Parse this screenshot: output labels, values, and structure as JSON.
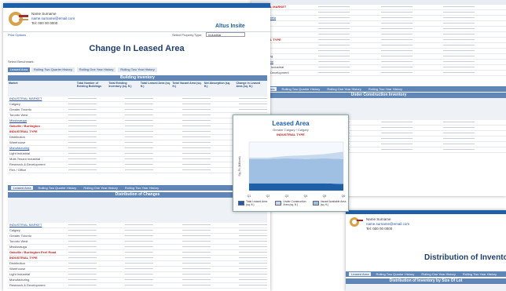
{
  "main_sheet": {
    "contact_name": "Name Surname",
    "contact_email": "name.surname@email.com",
    "contact_phone": "Tel: 000 00 0000",
    "brand_right": "Altus Insite",
    "select_label": "Select Property Type:",
    "select_value": "Industrial",
    "title": "Change In Leased Area",
    "summary_tab": "Leased Area",
    "tabs": [
      "Rolling Two Quarter History",
      "Rolling One Year History",
      "Rolling Two Year History"
    ],
    "inventory_title": "Building Inventory",
    "inventory_columns": [
      "Market",
      "Total Number of Existing Buildings",
      "Total Existing Inventory (sq. ft.)",
      "Total Leased Area (sq. ft.)",
      "Total Vacant Area (sq. ft.)",
      "Net Absorption (sq. ft.)",
      "Change in Leased Area (sq. ft.)"
    ],
    "inventory_rows": [
      {
        "label": "INDUSTRIAL MARKET",
        "style": "link"
      },
      {
        "label": "Calgary",
        "style": "plain"
      },
      {
        "label": "Greater Toronto",
        "style": "plain"
      },
      {
        "label": "Toronto West",
        "style": "plain"
      },
      {
        "label": "Mississauga",
        "style": "link"
      },
      {
        "label": "Oakville / Burlington",
        "style": "red"
      },
      {
        "label": "INDUSTRIAL TYPE",
        "style": "red"
      },
      {
        "label": "Distribution",
        "style": "plain"
      },
      {
        "label": "Warehouse",
        "style": "plain"
      },
      {
        "label": "Manufacturing",
        "style": "link"
      },
      {
        "label": "Light Industrial",
        "style": "plain"
      },
      {
        "label": "Multi-Tenant Industrial",
        "style": "plain"
      },
      {
        "label": "Research & Development",
        "style": "plain"
      },
      {
        "label": "Flex / Office",
        "style": "plain"
      }
    ],
    "distribution_title": "Distribution of Changes",
    "distribution_rows": [
      {
        "label": "INDUSTRIAL MARKET",
        "style": "link"
      },
      {
        "label": "Calgary",
        "style": "plain"
      },
      {
        "label": "Greater Toronto",
        "style": "plain"
      },
      {
        "label": "Toronto West",
        "style": "plain"
      },
      {
        "label": "Mississauga",
        "style": "plain"
      },
      {
        "label": "Oakville / Burlington Peel Road",
        "style": "red"
      },
      {
        "label": "INDUSTRIAL TYPE",
        "style": "red"
      },
      {
        "label": "Distribution",
        "style": "plain"
      },
      {
        "label": "Warehouse",
        "style": "plain"
      },
      {
        "label": "Light Industrial",
        "style": "plain"
      },
      {
        "label": "Manufacturing",
        "style": "plain"
      },
      {
        "label": "Research & Development",
        "style": "plain"
      }
    ]
  },
  "right_sheet": {
    "section_title": "Under Construction Inventory",
    "tabs": [
      "Leased Area",
      "Rolling Two Quarter History",
      "Rolling One Year History",
      "Rolling Two Year History"
    ],
    "rows": [
      {
        "label": "INDUSTRIAL MARKET",
        "style": "red"
      },
      {
        "label": "Calgary",
        "style": "plain"
      },
      {
        "label": "British Columbia",
        "style": "link"
      },
      {
        "label": "Vancouver",
        "style": "plain"
      },
      {
        "label": "Toronto",
        "style": "plain"
      },
      {
        "label": "Ottawa",
        "style": "link"
      },
      {
        "label": "INDUSTRIAL TYPE",
        "style": "red"
      },
      {
        "label": "Warehouse",
        "style": "plain"
      },
      {
        "label": "Distribution",
        "style": "link"
      },
      {
        "label": "Manufacturing",
        "style": "plain"
      },
      {
        "label": "Light Industrial",
        "style": "link"
      },
      {
        "label": "Multi-Tenant Industrial",
        "style": "plain"
      },
      {
        "label": "Research & Development",
        "style": "plain"
      }
    ]
  },
  "bottom_sheet": {
    "contact_name": "Name Surname",
    "contact_email": "name.surname@email.com",
    "contact_phone": "Tel: 000 00 0000",
    "title": "Distribution of Invento",
    "section_title": "Distribution of Inventory by Size Of Lot",
    "tabs": [
      "Leased Area",
      "Rolling Two Quarter History",
      "Rolling One Year History",
      "Rolling Two Year History"
    ]
  },
  "chart_card": {
    "title": "Leased Area",
    "subtitle": "Greater Calgary / Calgary",
    "type_label": "INDUSTRIAL TYPE",
    "legend": [
      "Total Leased Area (sq. ft.)",
      "Under Construction Area (sq. ft.)",
      "Vacant Available Area (sq. ft.)"
    ],
    "colors": {
      "leased": "#1f5fa8",
      "construction": "#c7d9ee",
      "vacant": "#9fc0e2"
    }
  },
  "chart_data": {
    "type": "area",
    "title": "Leased Area",
    "subtitle": "Greater Calgary / Calgary",
    "x": [
      "Q1",
      "Q2",
      "Q3",
      "Q4",
      "Q5",
      "Q6"
    ],
    "series": [
      {
        "name": "Total Leased Area (sq. ft.)",
        "values": [
          6,
          6,
          6,
          6,
          6,
          5.5
        ]
      },
      {
        "name": "Under Construction Area (sq. ft.)",
        "values": [
          20,
          20,
          20.5,
          20,
          20.5,
          20.5
        ]
      },
      {
        "name": "Vacant Available Area (sq. ft.)",
        "values": [
          1,
          1,
          2,
          3,
          3.5,
          6
        ]
      }
    ],
    "ylim": [
      0,
      40
    ],
    "stacked": true,
    "legend_position": "bottom"
  }
}
